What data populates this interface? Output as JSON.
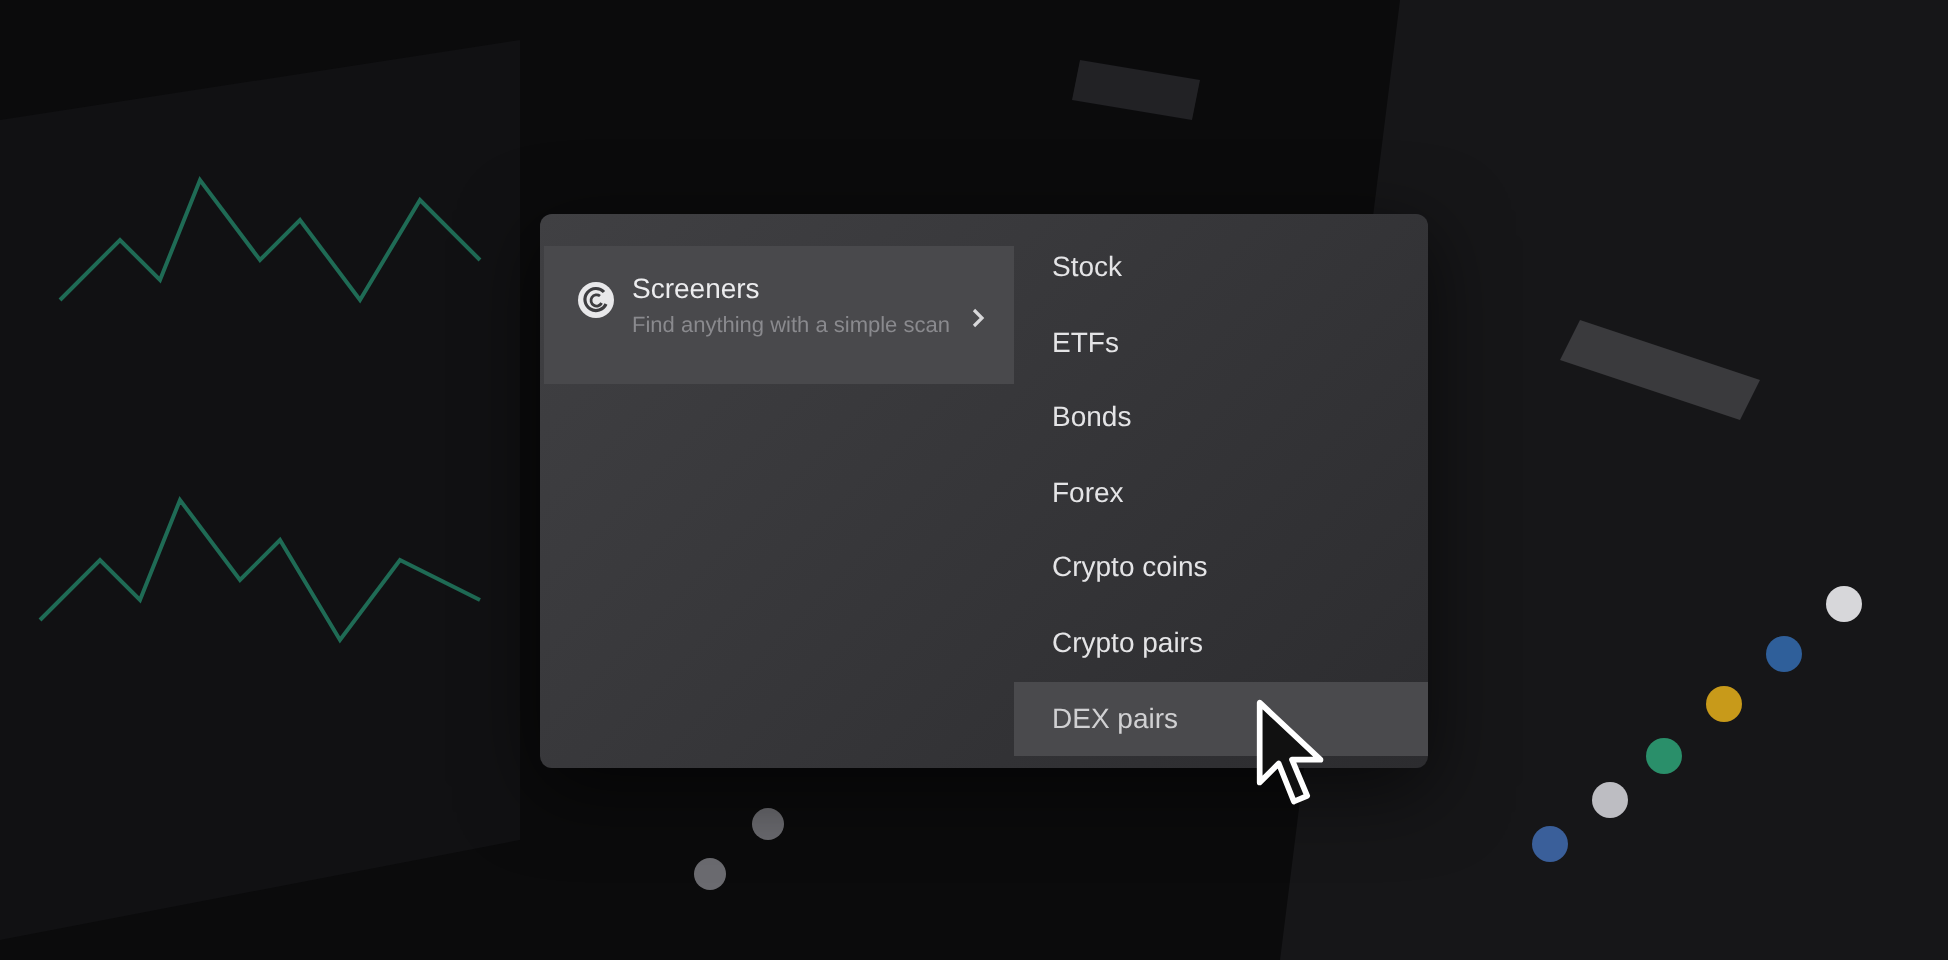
{
  "menu": {
    "category": {
      "title": "Screeners",
      "description": "Find anything with a simple scan",
      "selected": true
    },
    "items": [
      {
        "label": "Stock",
        "selected": false
      },
      {
        "label": "ETFs",
        "selected": false
      },
      {
        "label": "Bonds",
        "selected": false
      },
      {
        "label": "Forex",
        "selected": false
      },
      {
        "label": "Crypto coins",
        "selected": false
      },
      {
        "label": "Crypto pairs",
        "selected": false
      },
      {
        "label": "DEX pairs",
        "selected": true
      }
    ]
  }
}
